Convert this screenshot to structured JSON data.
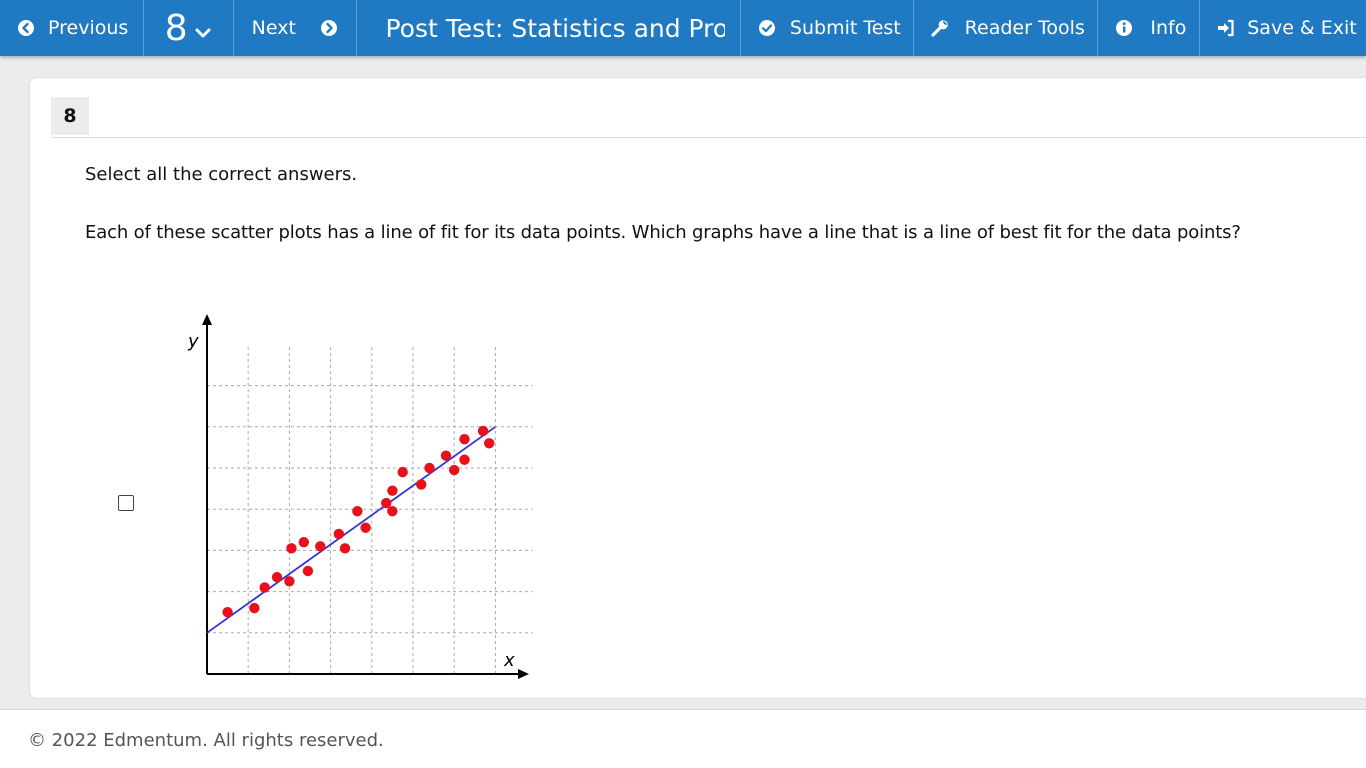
{
  "toolbar": {
    "previous_label": "Previous",
    "question_number": "8",
    "next_label": "Next",
    "title": "Post Test: Statistics and Proba",
    "submit_label": "Submit Test",
    "reader_tools_label": "Reader Tools",
    "info_label": "Info",
    "save_exit_label": "Save & Exit",
    "color": "#1f79c3"
  },
  "question": {
    "number": "8",
    "prompt": "Select all the correct answers.",
    "text": "Each of these scatter plots has a line of fit for its data points. Which graphs have a line that is a line of best fit for the data points?"
  },
  "answer_options": [
    {
      "checked": false,
      "chart_data": {
        "type": "scatter",
        "xlabel": "x",
        "ylabel": "y",
        "xlim": [
          0,
          8
        ],
        "ylim": [
          0,
          8
        ],
        "grid": true,
        "points": [
          [
            0.5,
            1.5
          ],
          [
            1.15,
            1.6
          ],
          [
            1.4,
            2.1
          ],
          [
            1.7,
            2.35
          ],
          [
            2.0,
            2.25
          ],
          [
            2.05,
            3.05
          ],
          [
            2.35,
            3.2
          ],
          [
            2.45,
            2.5
          ],
          [
            2.75,
            3.1
          ],
          [
            3.2,
            3.4
          ],
          [
            3.35,
            3.05
          ],
          [
            3.65,
            3.95
          ],
          [
            3.85,
            3.55
          ],
          [
            4.35,
            4.15
          ],
          [
            4.5,
            4.45
          ],
          [
            4.5,
            3.95
          ],
          [
            4.75,
            4.9
          ],
          [
            5.2,
            4.6
          ],
          [
            5.4,
            5.0
          ],
          [
            5.8,
            5.3
          ],
          [
            6.0,
            4.95
          ],
          [
            6.25,
            5.7
          ],
          [
            6.25,
            5.2
          ],
          [
            6.7,
            5.9
          ],
          [
            6.85,
            5.6
          ]
        ],
        "line": {
          "x": [
            0,
            7
          ],
          "y": [
            1.0,
            6.0
          ]
        },
        "point_color": "#e8101b",
        "line_color": "#3434d8"
      }
    }
  ],
  "footer": {
    "copyright": "© 2022 Edmentum. All rights reserved."
  }
}
